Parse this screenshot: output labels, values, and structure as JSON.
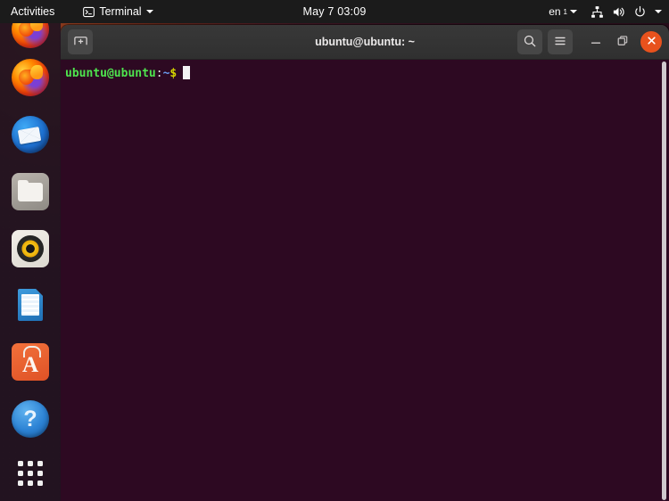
{
  "topbar": {
    "activities_label": "Activities",
    "app_menu_label": "Terminal",
    "app_menu_icon": "terminal-icon",
    "clock": "May 7  03:09",
    "keyboard_layout": "en",
    "keyboard_layout_sub": "1",
    "status_icons": [
      "network-wired-icon",
      "volume-icon",
      "power-icon",
      "chevron-down-icon"
    ]
  },
  "dock": {
    "items": [
      {
        "name": "ubuntu-wallpaper-app",
        "label": ""
      },
      {
        "name": "firefox",
        "label": "Firefox Web Browser"
      },
      {
        "name": "thunderbird",
        "label": "Thunderbird Mail"
      },
      {
        "name": "files",
        "label": "Files"
      },
      {
        "name": "rhythmbox",
        "label": "Rhythmbox"
      },
      {
        "name": "libreoffice-writer",
        "label": "LibreOffice Writer"
      },
      {
        "name": "ubuntu-software",
        "label": "Ubuntu Software"
      },
      {
        "name": "help",
        "label": "Help"
      },
      {
        "name": "show-applications",
        "label": "Show Applications"
      }
    ]
  },
  "window": {
    "title": "ubuntu@ubuntu: ~",
    "new_tab_icon": "new-tab-icon",
    "search_icon": "search-icon",
    "menu_icon": "hamburger-menu-icon",
    "minimize_icon": "minimize-icon",
    "maximize_icon": "maximize-icon",
    "close_icon": "close-icon",
    "close_color": "#e8521d",
    "titlebar_color": "#303030"
  },
  "terminal": {
    "background_color": "#2d0922",
    "prompt_user_host": "ubuntu@ubuntu",
    "prompt_colon": ":",
    "prompt_path": "~",
    "prompt_symbol": "$",
    "command_line": "",
    "user_color": "#4ee44e",
    "path_color": "#6a9cf0"
  }
}
